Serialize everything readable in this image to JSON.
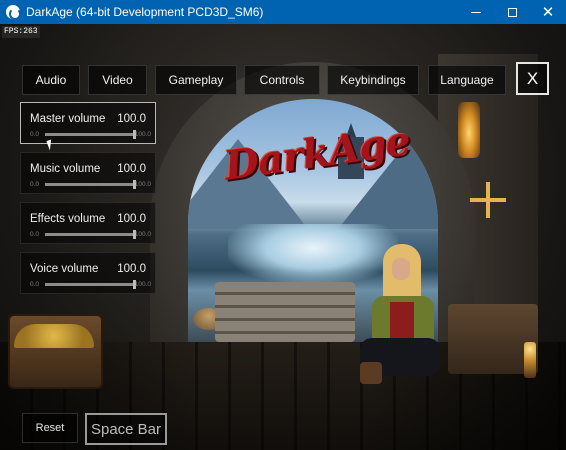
{
  "window": {
    "title": "DarkAge (64-bit Development PCD3D_SM6)",
    "close_glyph": "✕"
  },
  "hud": {
    "fps": "FPS:263"
  },
  "logo": {
    "text": "DarkAge"
  },
  "tabs": [
    {
      "label": "Audio"
    },
    {
      "label": "Video"
    },
    {
      "label": "Gameplay"
    },
    {
      "label": "Controls"
    },
    {
      "label": "Keybindings"
    },
    {
      "label": "Language"
    }
  ],
  "close_button": {
    "label": "X"
  },
  "volumes": [
    {
      "label": "Master volume",
      "value": "100.0",
      "min": "0.0",
      "max": "100.0",
      "level": 1.0
    },
    {
      "label": "Music volume",
      "value": "100.0",
      "min": "0.0",
      "max": "100.0",
      "level": 1.0
    },
    {
      "label": "Effects volume",
      "value": "100.0",
      "min": "0.0",
      "max": "100.0",
      "level": 1.0
    },
    {
      "label": "Voice volume",
      "value": "100.0",
      "min": "0.0",
      "max": "100.0",
      "level": 1.0
    }
  ],
  "footer": {
    "reset_label": "Reset",
    "key_hint": "Space Bar"
  }
}
